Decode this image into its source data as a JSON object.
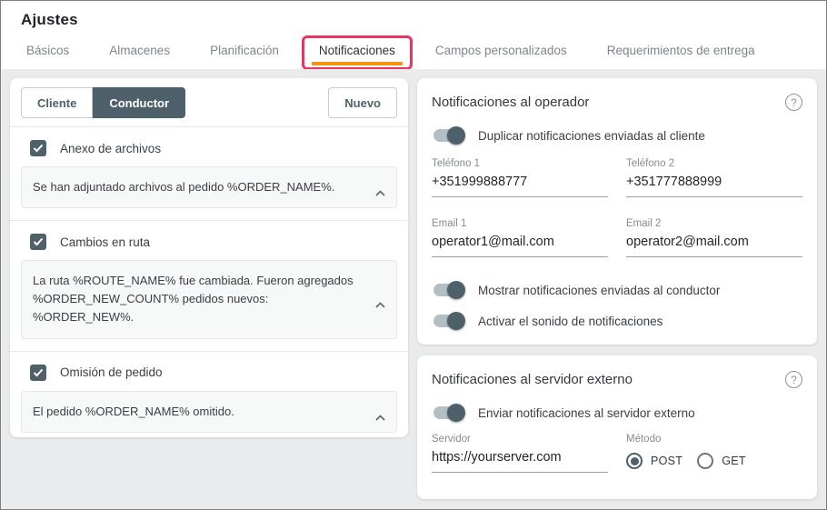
{
  "header": {
    "title": "Ajustes"
  },
  "tabs": {
    "items": [
      {
        "label": "Básicos",
        "active": false
      },
      {
        "label": "Almacenes",
        "active": false
      },
      {
        "label": "Planificación",
        "active": false
      },
      {
        "label": "Notificaciones",
        "active": true,
        "annotated": true
      },
      {
        "label": "Campos personalizados",
        "active": false
      },
      {
        "label": "Requerimientos de entrega",
        "active": false
      }
    ]
  },
  "left_panel": {
    "audience_segments": [
      {
        "label": "Cliente",
        "active": false
      },
      {
        "label": "Conductor",
        "active": true
      }
    ],
    "new_button_label": "Nuevo",
    "notifications": [
      {
        "label": "Anexo de archivos",
        "checked": true,
        "template": "Se han adjuntado archivos al pedido %ORDER_NAME%."
      },
      {
        "label": "Cambios en ruta",
        "checked": true,
        "template": "La ruta %ROUTE_NAME% fue cambiada. Fueron agregados %ORDER_NEW_COUNT% pedidos nuevos: %ORDER_NEW%."
      },
      {
        "label": "Omisión de pedido",
        "checked": true,
        "template": "El pedido %ORDER_NAME% omitido."
      }
    ]
  },
  "operator_panel": {
    "title": "Notificaciones al operador",
    "help_icon": "question-mark-circle",
    "duplicate_toggle": {
      "label": "Duplicar notificaciones enviadas al cliente",
      "on": true
    },
    "fields": {
      "phone1": {
        "label": "Teléfono 1",
        "value": "+351999888777"
      },
      "phone2": {
        "label": "Teléfono 2",
        "value": "+351777888999"
      },
      "email1": {
        "label": "Email 1",
        "value": "operator1@mail.com"
      },
      "email2": {
        "label": "Email 2",
        "value": "operator2@mail.com"
      }
    },
    "show_driver_toggle": {
      "label": "Mostrar notificaciones enviadas al conductor",
      "on": true
    },
    "sound_toggle": {
      "label": "Activar el sonido de notificaciones",
      "on": true
    }
  },
  "server_panel": {
    "title": "Notificaciones al servidor externo",
    "help_icon": "question-mark-circle",
    "send_toggle": {
      "label": "Enviar notificaciones al servidor externo",
      "on": true
    },
    "server_field": {
      "label": "Servidor",
      "value": "https://yourserver.com"
    },
    "method": {
      "label": "Método",
      "options": [
        {
          "label": "POST",
          "selected": true
        },
        {
          "label": "GET",
          "selected": false
        }
      ]
    }
  },
  "colors": {
    "accent": "#4e616b",
    "tab_active_underline": "#f5920f",
    "annotation_box": "#e8365f",
    "page_background": "#e9ebed"
  }
}
